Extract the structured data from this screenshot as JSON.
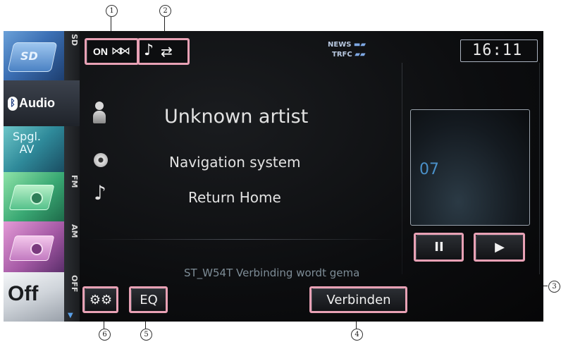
{
  "callouts": {
    "c1": "1",
    "c2": "2",
    "c3": "3",
    "c4": "4",
    "c5": "5",
    "c6": "6"
  },
  "sidebar": {
    "items": [
      {
        "id": "sd",
        "vertical_label": "SD",
        "icon": "sd-card-icon"
      },
      {
        "id": "audio",
        "label": "Audio",
        "icon": "bluetooth-icon"
      },
      {
        "id": "spgl",
        "label_line1": "Spgl.",
        "label_line2": "AV",
        "icon": "av-source-icon"
      },
      {
        "id": "fm",
        "vertical_label": "FM",
        "icon": "radio-icon"
      },
      {
        "id": "am",
        "vertical_label": "AM",
        "icon": "radio-icon"
      },
      {
        "id": "off",
        "label": "Off",
        "vertical_label": "OFF",
        "icon": "power-off-icon"
      }
    ]
  },
  "topbar": {
    "connection_label": "ON",
    "news_label": "NEWS",
    "trfc_label": "TRFC",
    "clock": "16:11"
  },
  "track": {
    "artist": "Unknown artist",
    "album": "Navigation system",
    "title": "Return Home",
    "track_number": "07"
  },
  "status_text": "ST_W54T Verbinding wordt gema",
  "buttons": {
    "eq_label": "EQ",
    "connect_label": "Verbinden",
    "pause_label": "II",
    "play_label": "▶"
  },
  "colors": {
    "highlight": "#e8a1b5",
    "screen_bg": "#0c0d0f",
    "audio_selected": "#2a2e36"
  }
}
